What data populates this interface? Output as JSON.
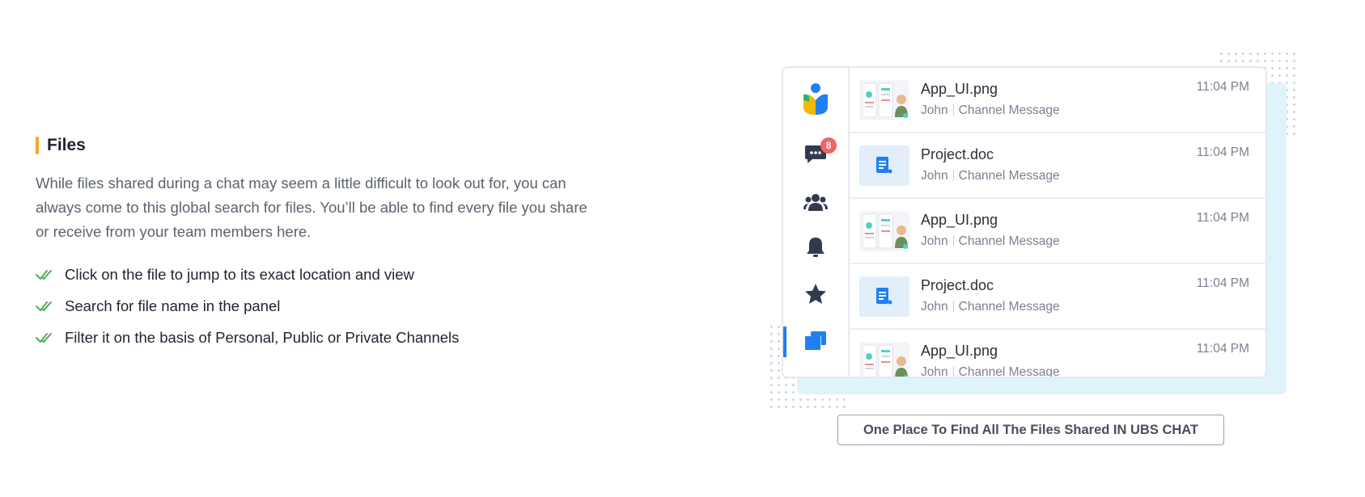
{
  "section": {
    "title": "Files",
    "accent_color": "#f5a623",
    "description": "While files shared during a chat may seem a little difficult to look out for, you can always come to this global search for files. You’ll be able to find every file you share or receive from your team members here.",
    "bullets": [
      "Click on the file to jump to its exact location and view",
      "Search for file name in the panel",
      "Filter it on the basis of Personal, Public or Private Channels"
    ],
    "bullet_icon": "double-check-icon",
    "bullet_icon_color": "#4caf50"
  },
  "mockup": {
    "rail": {
      "items": [
        "logo-icon",
        "chat-icon",
        "users-icon",
        "bell-icon",
        "star-icon",
        "files-icon"
      ],
      "chat_badge": "8",
      "active_item": "files-icon",
      "active_color": "#1f80f2"
    },
    "files": [
      {
        "name": "App_UI.png",
        "sender": "John",
        "type": "Channel Message",
        "time": "11:04 PM",
        "thumb": "image"
      },
      {
        "name": "Project.doc",
        "sender": "John",
        "type": "Channel Message",
        "time": "11:04 PM",
        "thumb": "doc"
      },
      {
        "name": "App_UI.png",
        "sender": "John",
        "type": "Channel Message",
        "time": "11:04 PM",
        "thumb": "image"
      },
      {
        "name": "Project.doc",
        "sender": "John",
        "type": "Channel Message",
        "time": "11:04 PM",
        "thumb": "doc"
      },
      {
        "name": "App_UI.png",
        "sender": "John",
        "type": "Channel Message",
        "time": "11:04 PM",
        "thumb": "image"
      }
    ],
    "caption": "One Place To Find All The Files Shared IN UBS CHAT"
  }
}
